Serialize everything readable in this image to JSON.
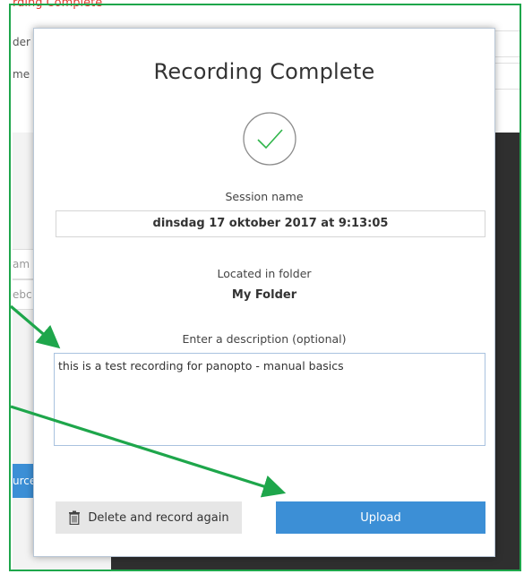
{
  "background": {
    "window_title": "rding Complete",
    "field_labels": [
      "der",
      "me"
    ],
    "left_fields": [
      "am C",
      "ebc"
    ],
    "left_button": "urce"
  },
  "modal": {
    "title": "Recording Complete",
    "session_label": "Session name",
    "session_name": "dinsdag 17 oktober 2017 at 9:13:05",
    "folder_label": "Located in folder",
    "folder_name": "My Folder",
    "description_label": "Enter a description (optional)",
    "description_value": "this is a test recording for panopto - manual basics",
    "delete_button_label": "Delete and record again",
    "upload_button_label": "Upload"
  },
  "colors": {
    "accent": "#3c8fd6",
    "annotation_green": "#1ea64b",
    "check_green": "#2fb54a"
  },
  "icons": [
    "checkmark-circle-icon",
    "trash-icon"
  ]
}
